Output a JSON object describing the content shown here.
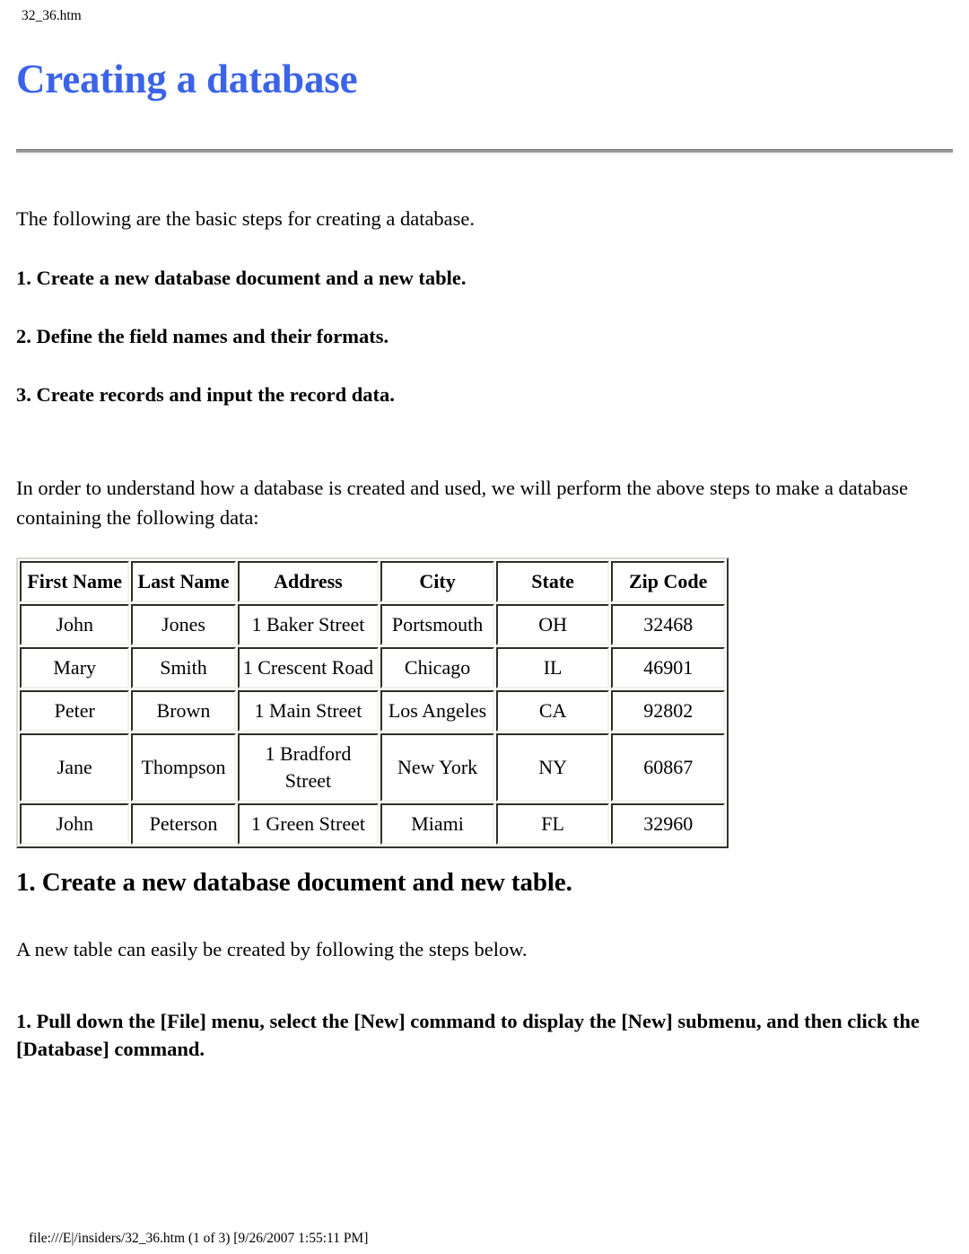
{
  "header": {
    "file_label": "32_36.htm"
  },
  "title": "Creating a database",
  "intro": "The following are the basic steps for creating a database.",
  "steps": [
    "1. Create a new database document and a new table.",
    "2. Define the field names and their formats.",
    "3. Create records and input the record data."
  ],
  "paragraph_2": "In order to understand how a database is created and used, we will perform the above steps to make a database containing the following data:",
  "table": {
    "headers": [
      "First Name",
      "Last Name",
      "Address",
      "City",
      "State",
      "Zip Code"
    ],
    "rows": [
      [
        "John",
        "Jones",
        "1 Baker Street",
        "Portsmouth",
        "OH",
        "32468"
      ],
      [
        "Mary",
        "Smith",
        "1 Crescent Road",
        "Chicago",
        "IL",
        "46901"
      ],
      [
        "Peter",
        "Brown",
        "1 Main Street",
        "Los Angeles",
        "CA",
        "92802"
      ],
      [
        "Jane",
        "Thompson",
        "1 Bradford Street",
        "New York",
        "NY",
        "60867"
      ],
      [
        "John",
        "Peterson",
        "1 Green Street",
        "Miami",
        "FL",
        "32960"
      ]
    ]
  },
  "section_heading": "1. Create a new database document and new table.",
  "paragraph_3": "A new table can easily be created by following the steps below.",
  "instruction": "1. Pull down the [File] menu, select the [New] command to display the [New] submenu, and then click the [Database] command.",
  "footer": "file:///E|/insiders/32_36.htm (1 of 3) [9/26/2007 1:55:11 PM]",
  "colors": {
    "title": "#3b63e8",
    "text": "#000000",
    "table_border": "#81816f",
    "background": "#ffffff"
  }
}
